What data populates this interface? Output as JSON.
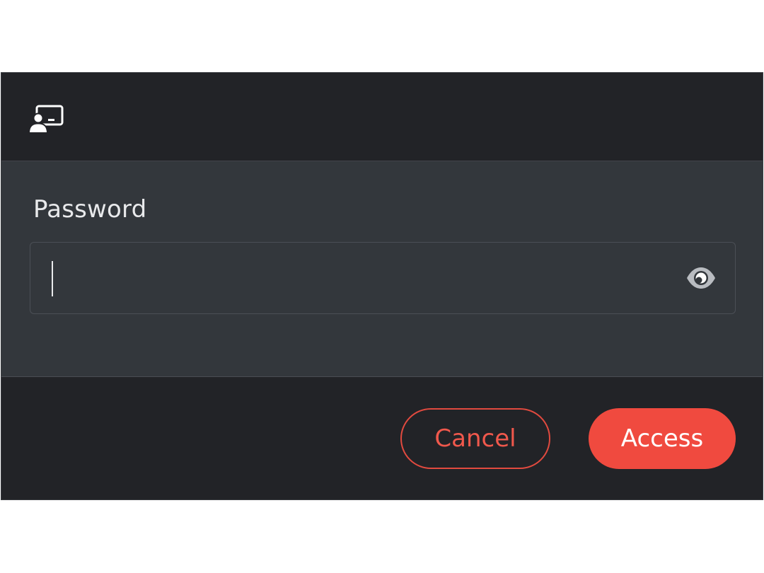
{
  "header": {
    "icon": "screen-share-user-icon"
  },
  "form": {
    "password_label": "Password",
    "password_value": "",
    "password_placeholder": "",
    "toggle_icon": "eye-icon"
  },
  "footer": {
    "cancel_label": "Cancel",
    "access_label": "Access"
  },
  "colors": {
    "accent": "#f04a3f",
    "header_bg": "#222327",
    "body_bg": "#33373c",
    "text": "#e9eaec"
  }
}
